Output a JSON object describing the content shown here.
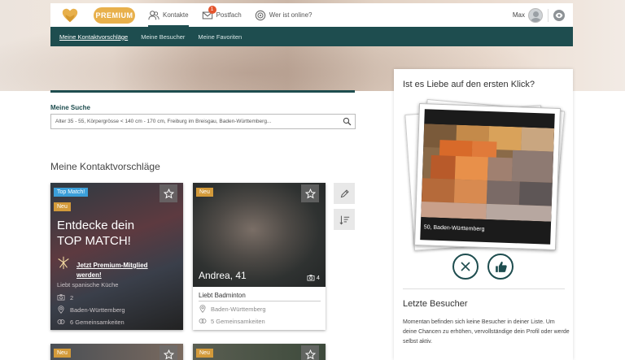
{
  "header": {
    "premium_label": "PREMIUM",
    "nav": [
      {
        "label": "Kontakte",
        "icon": "contacts-icon",
        "active": true
      },
      {
        "label": "Postfach",
        "icon": "mail-icon",
        "badge": "1"
      },
      {
        "label": "Wer ist online?",
        "icon": "online-icon"
      }
    ],
    "user_name": "Max"
  },
  "subnav": [
    "Meine Kontaktvorschläge",
    "Meine Besucher",
    "Meine Favoriten"
  ],
  "search": {
    "label": "Meine Suche",
    "value": "Alter 35 - 55, Körpergrösse < 140 cm - 170 cm, Freiburg im Breisgau, Baden-Württemberg..."
  },
  "section_title": "Meine Kontaktvorschläge",
  "cards": {
    "top_match": {
      "tag_top": "Top Match!",
      "tag_new": "Neu",
      "title_line1": "Entdecke dein",
      "title_line2": "TOP MATCH!",
      "cta_line1": "Jetzt Premium-Mitglied",
      "cta_line2": "werden!",
      "likes": "Liebt spanische Küche",
      "photos": "2",
      "location": "Baden-Württemberg",
      "common": "6 Gemeinsamkeiten"
    },
    "andrea": {
      "tag_new": "Neu",
      "name": "Andrea, 41",
      "photos": "4",
      "likes": "Liebt Badminton",
      "location": "Baden-Württemberg",
      "common": "5 Gemeinsamkeiten"
    },
    "bottom_left_tag": "Neu",
    "bottom_right_tag": "Neu"
  },
  "right_panel": {
    "title": "Ist es Liebe auf den ersten Klick?",
    "photo_caption": "50, Baden-Württemberg",
    "visitors_title": "Letzte Besucher",
    "visitors_text": "Momentan befinden sich keine Besucher in deiner Liste. Um deine Chancen zu erhöhen, vervollständige dein Profil oder werde selbst aktiv."
  },
  "colors": {
    "brand_dark": "#1e4d4f",
    "premium": "#e8b04b",
    "badge": "#e4552e",
    "tag_top": "#3b9fd9",
    "tag_new": "#d39a3a"
  }
}
